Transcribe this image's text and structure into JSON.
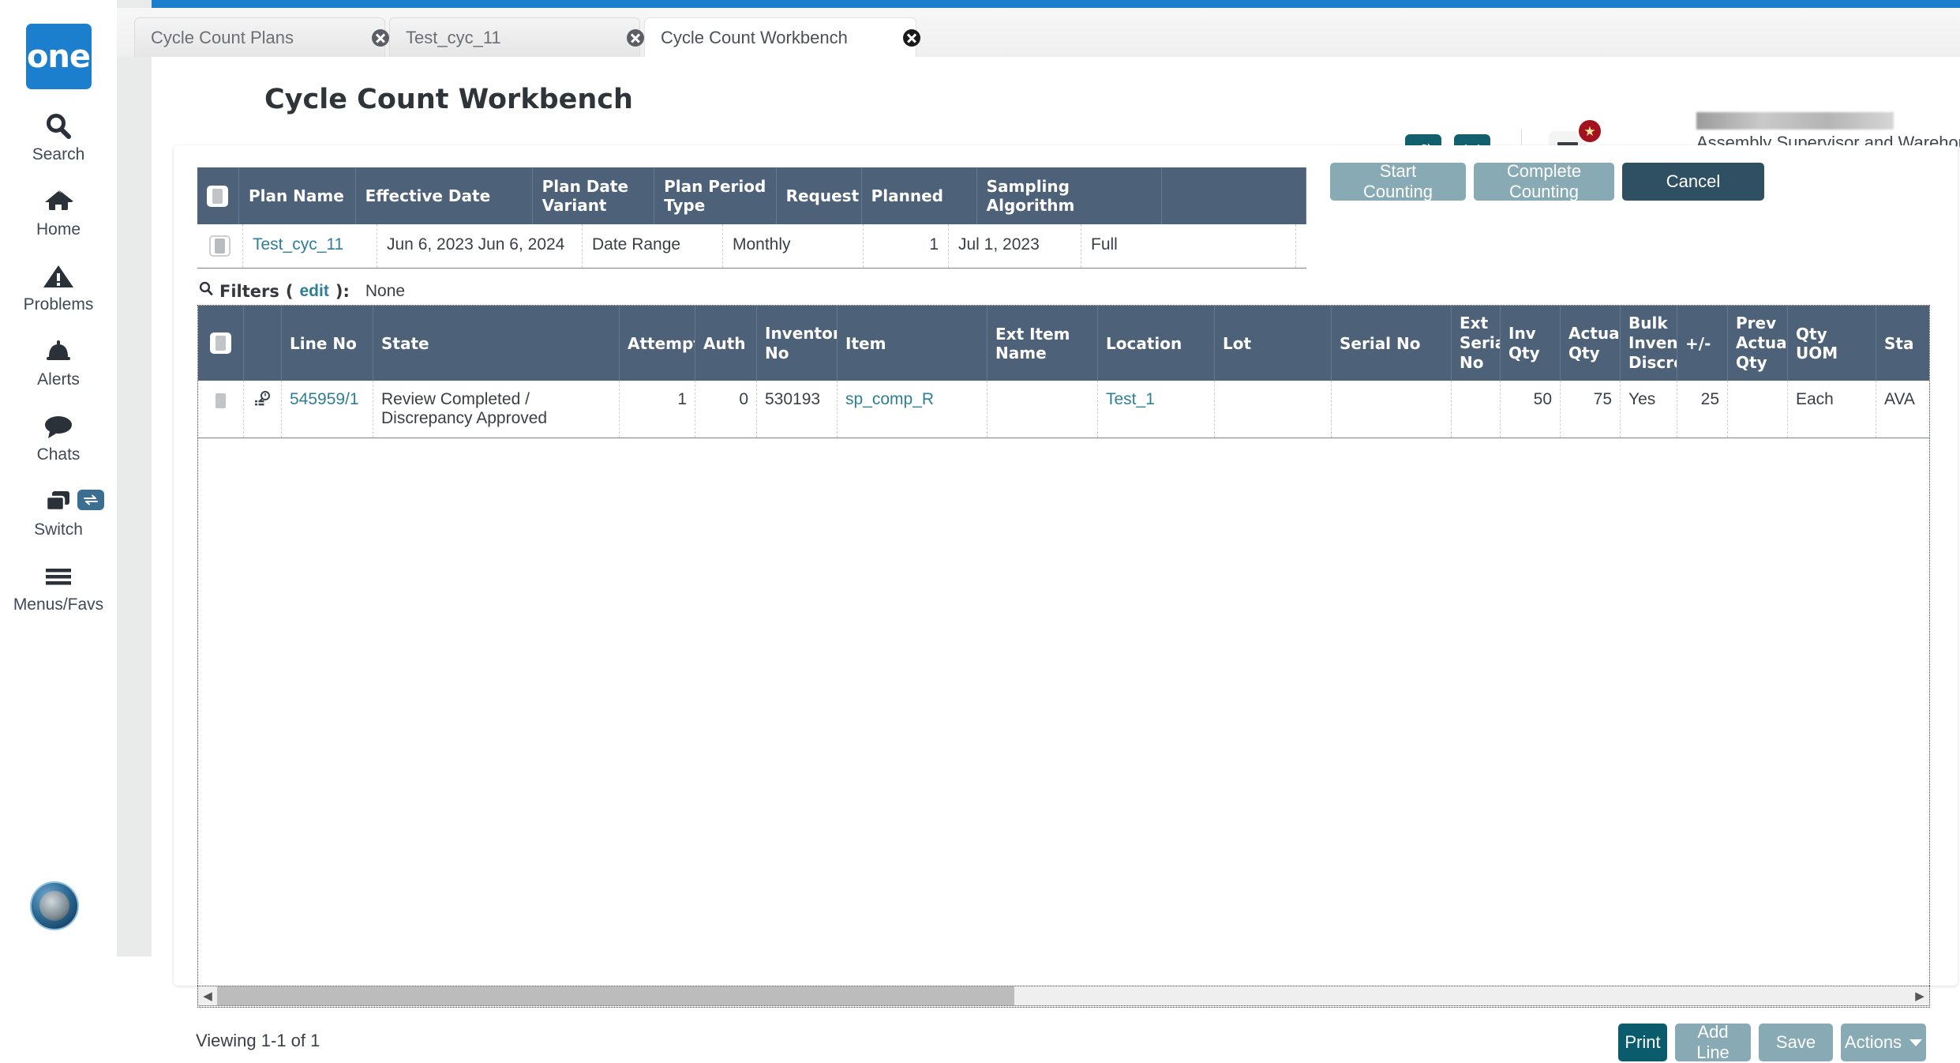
{
  "brand": {
    "logo_text": "one",
    "accent_blue": "#1b7fce",
    "header_navy": "#4d6179",
    "teal": "#12606e"
  },
  "left_nav": {
    "items": [
      {
        "label": "Search",
        "icon": "search-icon"
      },
      {
        "label": "Home",
        "icon": "home-icon"
      },
      {
        "label": "Problems",
        "icon": "warning-triangle-icon"
      },
      {
        "label": "Alerts",
        "icon": "bell-icon"
      },
      {
        "label": "Chats",
        "icon": "chat-bubble-icon"
      },
      {
        "label": "Switch",
        "icon": "switch-windows-icon",
        "badge_icon": "swap-arrows-icon"
      },
      {
        "label": "Menus/Favs",
        "icon": "hamburger-icon"
      }
    ]
  },
  "tabs": [
    {
      "label": "Cycle Count Plans",
      "active": false
    },
    {
      "label": "Test_cyc_11",
      "active": false
    },
    {
      "label": "Cycle Count Workbench",
      "active": true
    }
  ],
  "header": {
    "title": "Cycle Count Workbench",
    "refresh_icon": "refresh-icon",
    "close_icon": "close-x-icon",
    "menu_icon": "list-menu-icon",
    "badge_icon": "star-badge-icon",
    "user_role": "Assembly Supervisor and Warehouse Manager",
    "caret_icon": "chevron-down-icon"
  },
  "plan_table": {
    "columns": [
      "Plan Name",
      "Effective Date",
      "Plan Date Variant",
      "Plan Period Type",
      "Request",
      "Planned",
      "Sampling Algorithm"
    ],
    "rows": [
      {
        "plan_name": "Test_cyc_11",
        "effective_date": "Jun 6, 2023 Jun 6, 2024",
        "plan_date_variant": "Date Range",
        "plan_period_type": "Monthly",
        "request": "1",
        "planned": "Jul 1, 2023",
        "sampling_algorithm": "Full"
      }
    ]
  },
  "plan_actions": {
    "start_counting": "Start Counting",
    "complete_counting": "Complete Counting",
    "cancel": "Cancel"
  },
  "filters": {
    "icon": "search-icon",
    "label": "Filters",
    "edit_link": "edit",
    "paren_open": "(",
    "paren_close": "):",
    "value": "None"
  },
  "lines_table": {
    "columns": [
      "Line No",
      "State",
      "Attempt",
      "Auth",
      "Inventory No",
      "Item",
      "Ext Item Name",
      "Location",
      "Lot",
      "Serial No",
      "Ext Serial No",
      "Inv Qty",
      "Actual Qty",
      "Bulk Inventory Discrepa",
      "+/-",
      "Prev Actual Qty",
      "Qty UOM",
      "Sta"
    ],
    "rows": [
      {
        "detail_icon": "magnifier-detail-icon",
        "line_no": "545959/1",
        "state": "Review Completed / Discrepancy Approved",
        "attempt": "1",
        "auth": "0",
        "inventory_no": "530193",
        "item": "sp_comp_R",
        "ext_item_name": "",
        "location": "Test_1",
        "lot": "",
        "serial_no": "",
        "ext_serial_no": "",
        "inv_qty": "50",
        "actual_qty": "75",
        "bulk_inventory_discrepancy": "Yes",
        "plus_minus": "25",
        "prev_actual_qty": "",
        "qty_uom": "Each",
        "status": "AVA"
      }
    ]
  },
  "scroll": {
    "left_arrow": "◀",
    "right_arrow": "▶"
  },
  "footer": {
    "status": "Viewing 1-1 of 1",
    "print": "Print",
    "add_line": "Add Line",
    "save": "Save",
    "actions": "Actions"
  }
}
